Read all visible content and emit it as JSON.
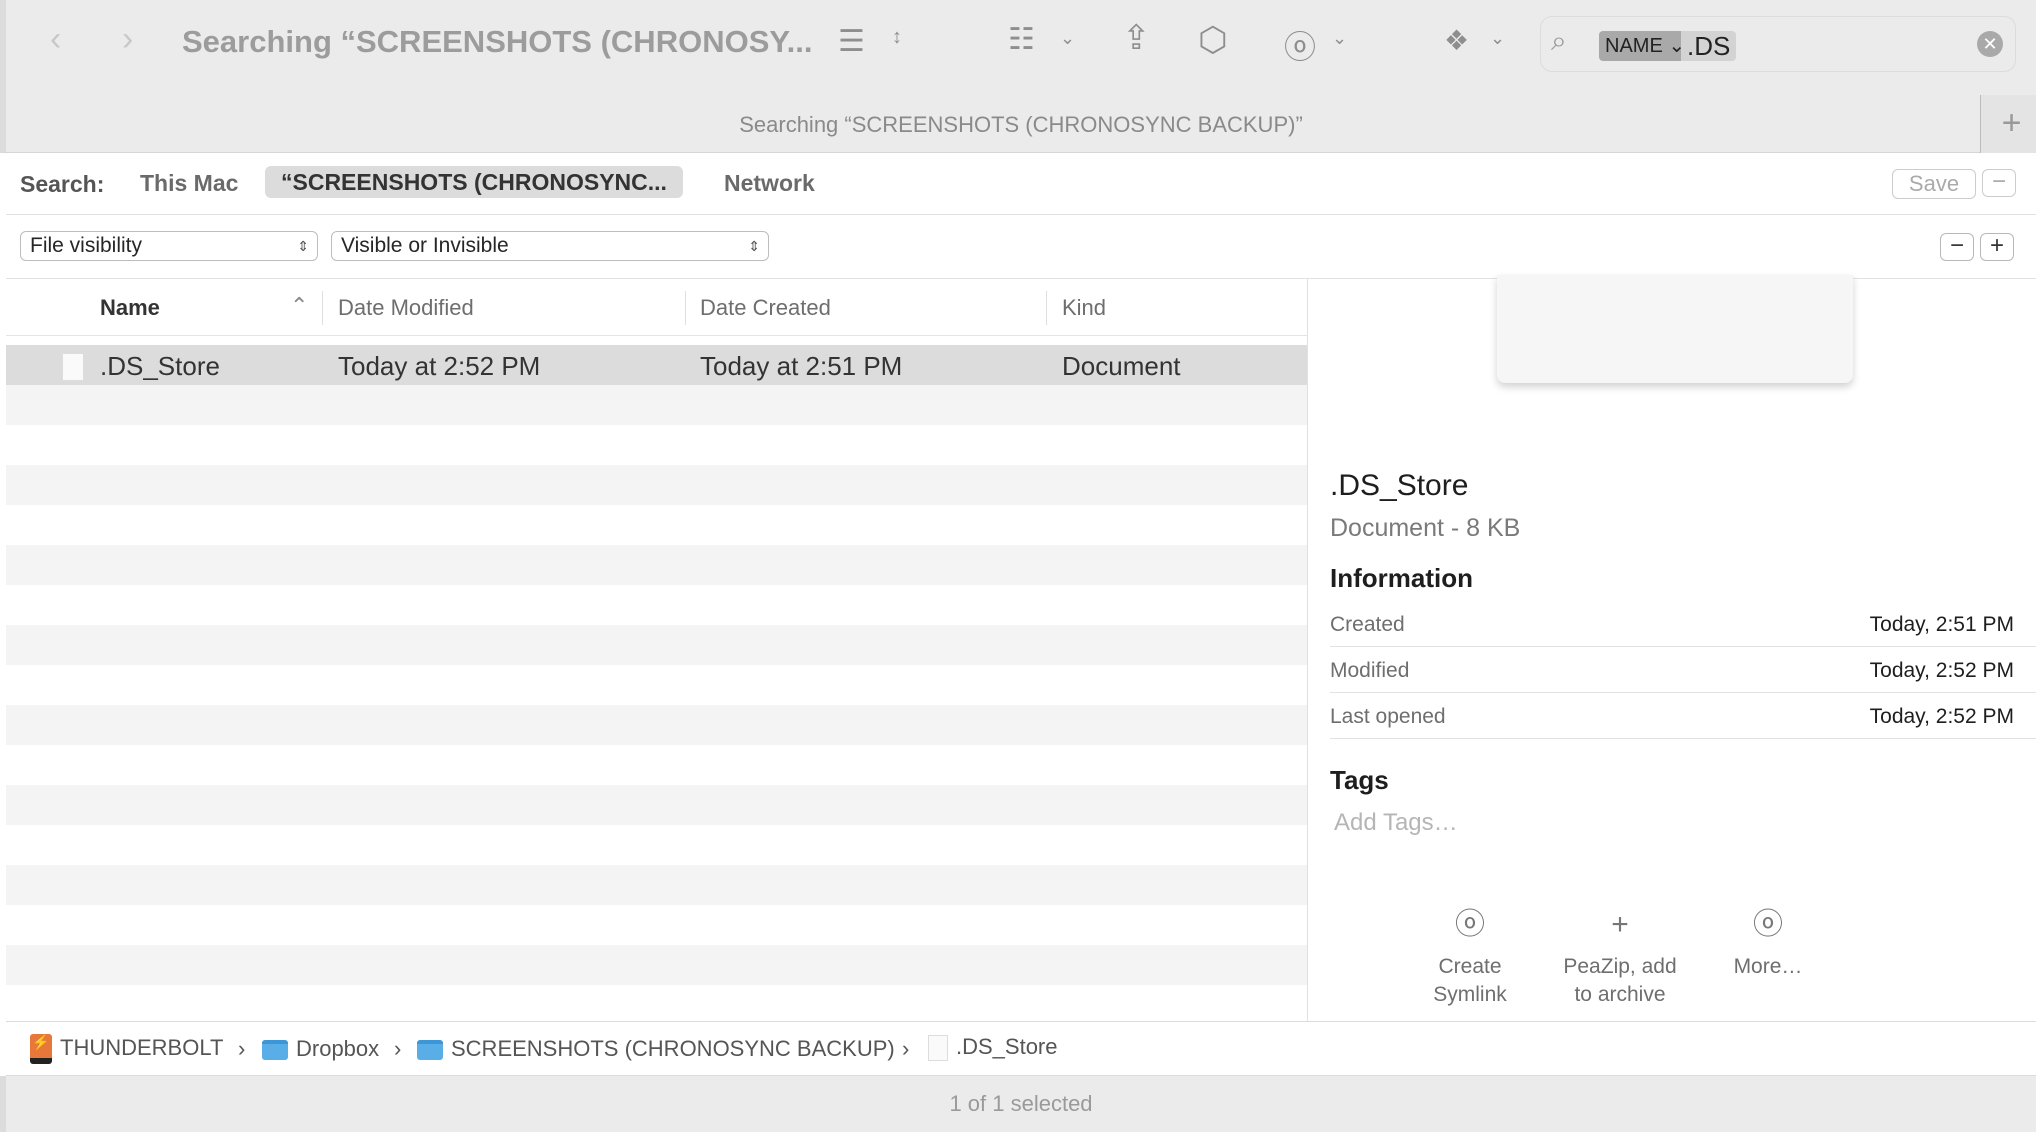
{
  "toolbar": {
    "title": "Searching “SCREENSHOTS (CHRONOSY...",
    "icons": [
      "back-icon",
      "forward-icon",
      "list-view-icon",
      "group-icon",
      "share-icon",
      "tag-icon",
      "more-icon",
      "dropbox-icon",
      "search-icon",
      "clear-icon"
    ],
    "search": {
      "token_label": "NAME",
      "token_value": ".DS"
    }
  },
  "tabbar": {
    "title": "Searching “SCREENSHOTS (CHRONOSYNC BACKUP)”"
  },
  "scope": {
    "label": "Search:",
    "options": [
      "This Mac",
      "“SCREENSHOTS (CHRONOSYNC...",
      "Network"
    ],
    "selected": 1,
    "save": "Save"
  },
  "filter": {
    "attribute": "File visibility",
    "value": "Visible or Invisible"
  },
  "list": {
    "columns": [
      "Name",
      "Date Modified",
      "Date Created",
      "Kind"
    ],
    "sort_column": "Name",
    "sort": "ascending",
    "rows": [
      {
        "name": ".DS_Store",
        "modified": "Today at 2:52 PM",
        "created": "Today at 2:51 PM",
        "kind": "Document"
      }
    ]
  },
  "preview": {
    "name": ".DS_Store",
    "subtitle": "Document - 8 KB",
    "info_title": "Information",
    "info": [
      {
        "k": "Created",
        "v": "Today, 2:51 PM"
      },
      {
        "k": "Modified",
        "v": "Today, 2:52 PM"
      },
      {
        "k": "Last opened",
        "v": "Today, 2:52 PM"
      }
    ],
    "tags_title": "Tags",
    "tags_placeholder": "Add Tags…",
    "actions": [
      {
        "label1": "Create",
        "label2": "Symlink",
        "icon": "ellipsis-circle-icon"
      },
      {
        "label1": "PeaZip, add",
        "label2": "to archive",
        "icon": "plus-icon"
      },
      {
        "label1": "More…",
        "label2": "",
        "icon": "ellipsis-circle-icon"
      }
    ]
  },
  "pathbar": [
    "THUNDERBOLT",
    "Dropbox",
    "SCREENSHOTS (CHRONOSYNC BACKUP)",
    ".DS_Store"
  ],
  "status": "1 of 1 selected",
  "colors": {
    "selection": "#dcdcdc",
    "folder": "#5aaee8",
    "drive": "#e8783a"
  }
}
